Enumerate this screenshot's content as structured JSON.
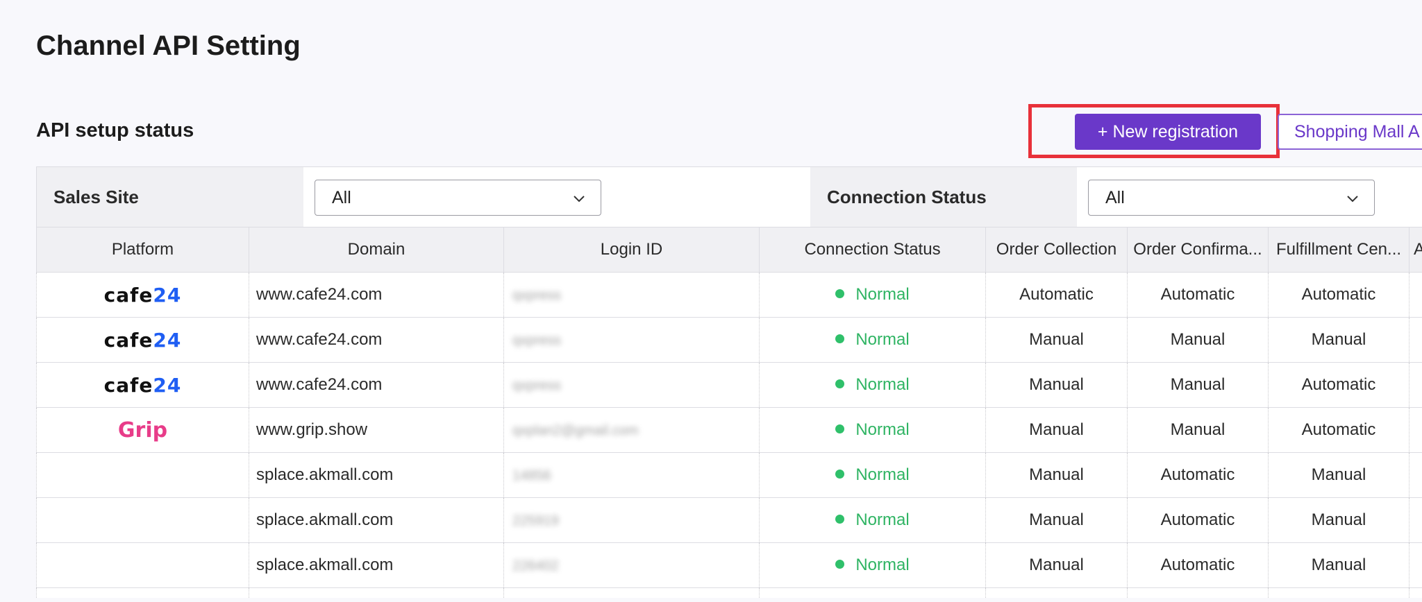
{
  "page": {
    "title": "Channel API Setting",
    "section_title": "API setup status"
  },
  "toolbar": {
    "new_registration_label": "+ New registration",
    "shopping_mall_label": "Shopping Mall A"
  },
  "filters": {
    "sales_site_label": "Sales Site",
    "sales_site_value": "All",
    "connection_status_label": "Connection Status",
    "connection_status_value": "All"
  },
  "table": {
    "columns": [
      "Platform",
      "Domain",
      "Login ID",
      "Connection Status",
      "Order Collection",
      "Order Confirma...",
      "Fulfillment Cen...",
      "Au"
    ],
    "rows": [
      {
        "platform": "cafe24",
        "domain": "www.cafe24.com",
        "login": "qxpress",
        "status": "Normal",
        "order_collection": "Automatic",
        "order_confirmation": "Automatic",
        "fulfillment": "Automatic"
      },
      {
        "platform": "cafe24",
        "domain": "www.cafe24.com",
        "login": "qxpress",
        "status": "Normal",
        "order_collection": "Manual",
        "order_confirmation": "Manual",
        "fulfillment": "Manual"
      },
      {
        "platform": "cafe24",
        "domain": "www.cafe24.com",
        "login": "qxpress",
        "status": "Normal",
        "order_collection": "Manual",
        "order_confirmation": "Manual",
        "fulfillment": "Automatic"
      },
      {
        "platform": "grip",
        "domain": "www.grip.show",
        "login": "qxplan2@gmail.com",
        "status": "Normal",
        "order_collection": "Manual",
        "order_confirmation": "Manual",
        "fulfillment": "Automatic"
      },
      {
        "platform": "",
        "domain": "splace.akmall.com",
        "login": "14856",
        "status": "Normal",
        "order_collection": "Manual",
        "order_confirmation": "Automatic",
        "fulfillment": "Manual"
      },
      {
        "platform": "",
        "domain": "splace.akmall.com",
        "login": "225919",
        "status": "Normal",
        "order_collection": "Manual",
        "order_confirmation": "Automatic",
        "fulfillment": "Manual"
      },
      {
        "platform": "",
        "domain": "splace.akmall.com",
        "login": "226402",
        "status": "Normal",
        "order_collection": "Manual",
        "order_confirmation": "Automatic",
        "fulfillment": "Manual"
      }
    ]
  },
  "logos": {
    "cafe24_text": "cafe",
    "cafe24_num": "24",
    "grip_text": "Grip"
  },
  "colors": {
    "accent": "#6a38c9",
    "status_normal": "#2fb463",
    "highlight": "#e8313a"
  },
  "icons": {
    "dropdown": "chevron-down-icon",
    "status": "status-dot-icon"
  }
}
